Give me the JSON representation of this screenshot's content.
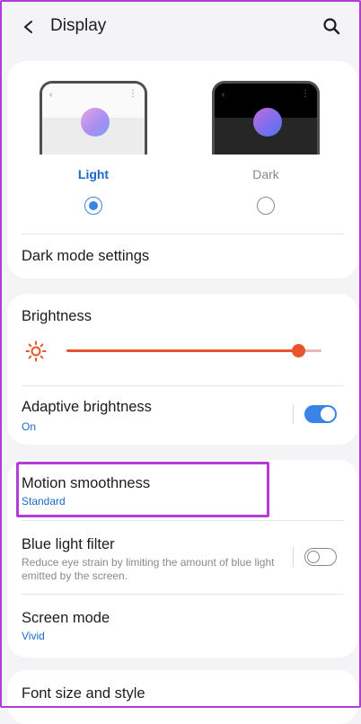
{
  "header": {
    "title": "Display"
  },
  "theme": {
    "light": {
      "label": "Light",
      "selected": true
    },
    "dark": {
      "label": "Dark",
      "selected": false
    }
  },
  "dark_mode_settings": {
    "label": "Dark mode settings"
  },
  "brightness": {
    "label": "Brightness",
    "level": 0.91
  },
  "adaptive_brightness": {
    "label": "Adaptive brightness",
    "status": "On",
    "enabled": true
  },
  "motion_smoothness": {
    "label": "Motion smoothness",
    "value": "Standard"
  },
  "blue_light_filter": {
    "label": "Blue light filter",
    "description": "Reduce eye strain by limiting the amount of blue light emitted by the screen.",
    "enabled": false
  },
  "screen_mode": {
    "label": "Screen mode",
    "value": "Vivid"
  },
  "font_size": {
    "label": "Font size and style"
  },
  "colors": {
    "accent": "#3a84e8",
    "slider": "#e8542b",
    "highlight": "#b43cd6"
  }
}
